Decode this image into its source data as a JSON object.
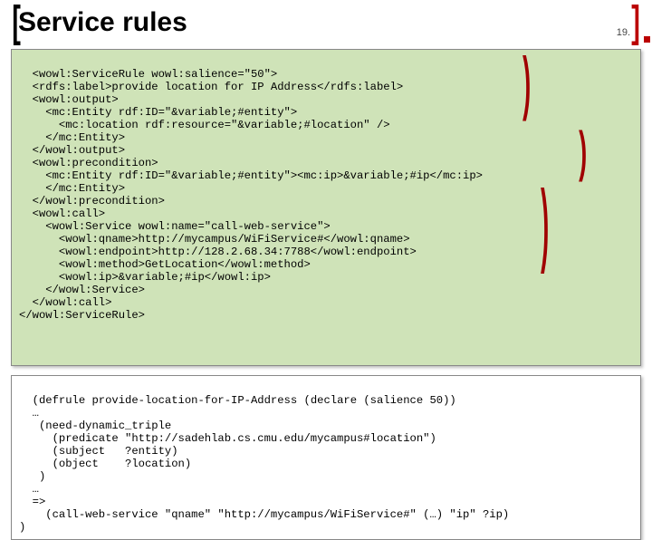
{
  "header": {
    "title": "Service rules",
    "page_number": "19."
  },
  "xml_code": "<wowl:ServiceRule wowl:salience=\"50\">\n  <rdfs:label>provide location for IP Address</rdfs:label>\n  <wowl:output>\n    <mc:Entity rdf:ID=\"&variable;#entity\">\n      <mc:location rdf:resource=\"&variable;#location\" />\n    </mc:Entity>\n  </wowl:output>\n  <wowl:precondition>\n    <mc:Entity rdf:ID=\"&variable;#entity\"><mc:ip>&variable;#ip</mc:ip>\n    </mc:Entity>\n  </wowl:precondition>\n  <wowl:call>\n    <wowl:Service wowl:name=\"call-web-service\">\n      <wowl:qname>http://mycampus/WiFiService#</wowl:qname>\n      <wowl:endpoint>http://128.2.68.34:7788</wowl:endpoint>\n      <wowl:method>GetLocation</wowl:method>\n      <wowl:ip>&variable;#ip</wowl:ip>\n    </wowl:Service>\n  </wowl:call>\n</wowl:ServiceRule>",
  "lisp_code": "(defrule provide-location-for-IP-Address (declare (salience 50))\n  …\n   (need-dynamic_triple\n     (predicate \"http://sadehlab.cs.cmu.edu/mycampus#location\")\n     (subject   ?entity)\n     (object    ?location)\n   )\n  …\n  =>\n    (call-web-service \"qname\" \"http://mycampus/WiFiService#\" (…) \"ip\" ?ip)\n)",
  "icons": {
    "bracket_left": "[",
    "bracket_right": "]"
  }
}
